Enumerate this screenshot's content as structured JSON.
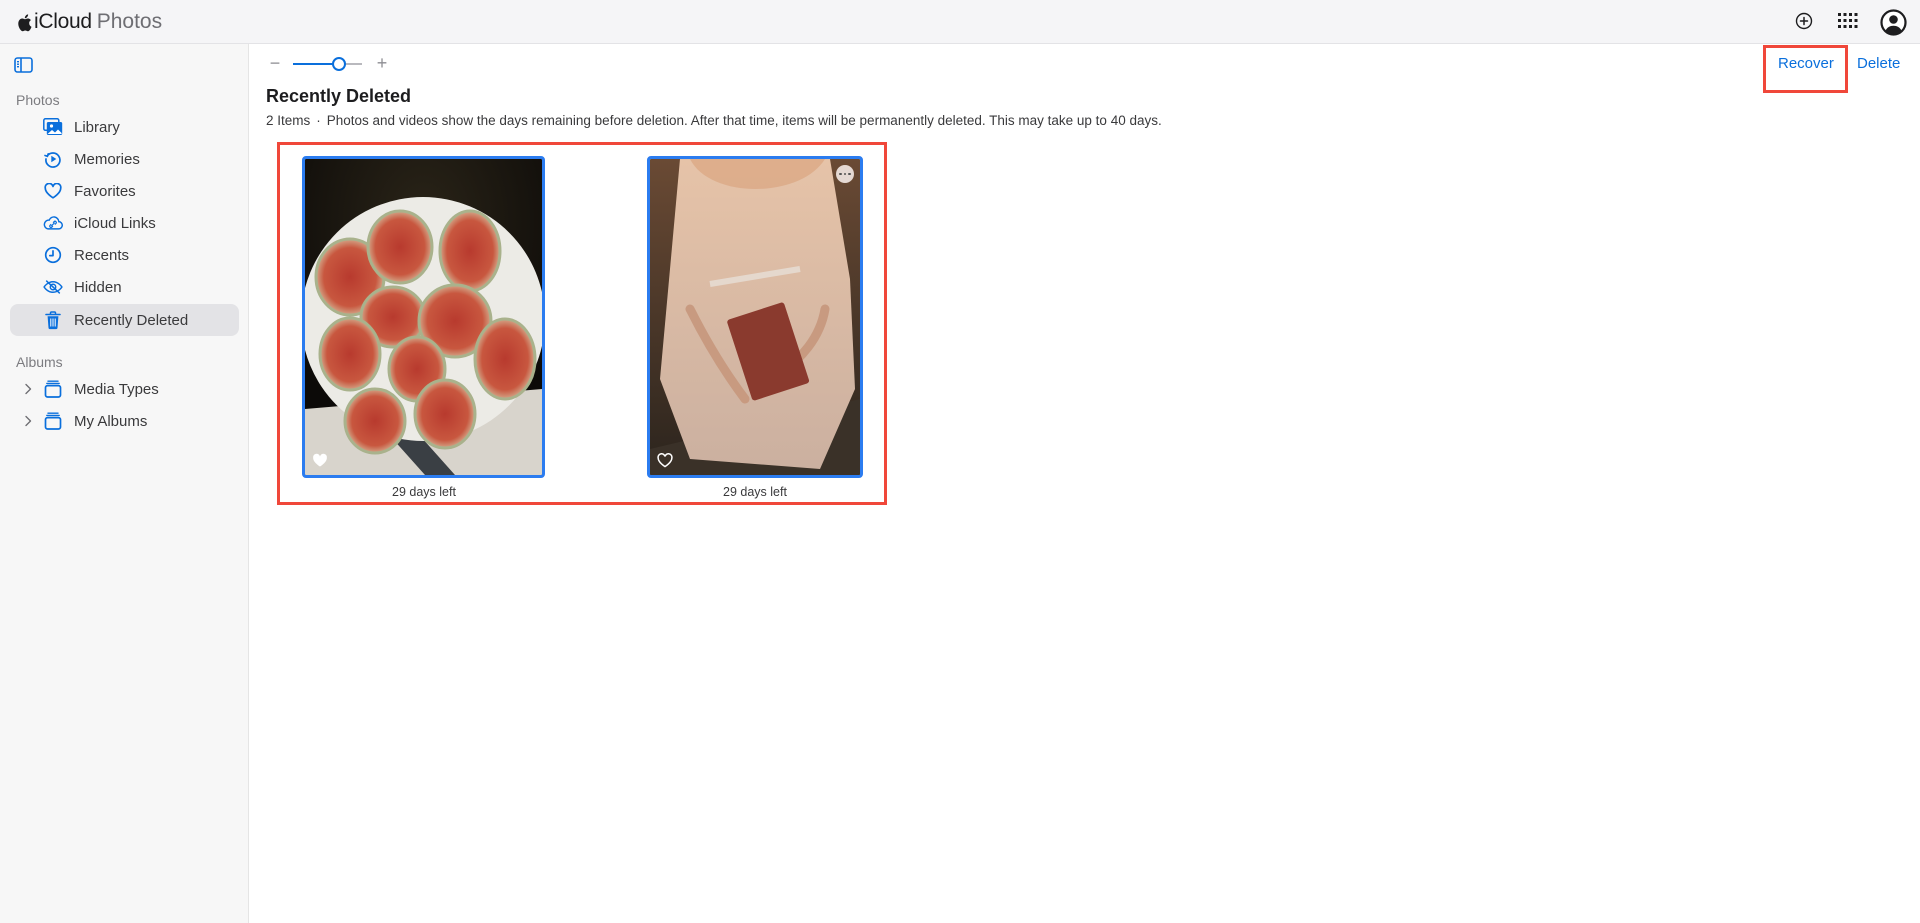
{
  "header": {
    "brand_primary": "iCloud",
    "brand_secondary": "Photos",
    "icons": [
      "apple-logo",
      "add-circle-icon",
      "app-grid-icon",
      "account-icon"
    ]
  },
  "sidebar": {
    "toggle_icon": "sidebar-toggle-icon",
    "photos_section": {
      "label": "Photos",
      "items": [
        {
          "label": "Library",
          "icon": "library-icon",
          "active": false
        },
        {
          "label": "Memories",
          "icon": "memories-icon",
          "active": false
        },
        {
          "label": "Favorites",
          "icon": "heart-icon",
          "active": false
        },
        {
          "label": "iCloud Links",
          "icon": "cloud-link-icon",
          "active": false
        },
        {
          "label": "Recents",
          "icon": "clock-icon",
          "active": false
        },
        {
          "label": "Hidden",
          "icon": "eye-slash-icon",
          "active": false
        },
        {
          "label": "Recently Deleted",
          "icon": "trash-icon",
          "active": true
        }
      ]
    },
    "albums_section": {
      "label": "Albums",
      "items": [
        {
          "label": "Media Types",
          "icon": "album-stack-icon",
          "expandable": true
        },
        {
          "label": "My Albums",
          "icon": "album-stack-icon",
          "expandable": true
        }
      ]
    }
  },
  "main": {
    "zoom": {
      "minus_label": "−",
      "plus_label": "+",
      "level": 0.67
    },
    "title": "Recently Deleted",
    "item_count": "2 Items",
    "separator": "·",
    "description": "Photos and videos show the days remaining before deletion. After that time, items will be permanently deleted. This may take up to 40 days.",
    "actions": {
      "recover_label": "Recover",
      "delete_label": "Delete"
    },
    "photos": [
      {
        "subject": "figs on white plate",
        "caption": "29 days left",
        "favorite": true,
        "selected": true
      },
      {
        "subject": "woman in tulle dress holding book",
        "caption": "29 days left",
        "favorite": false,
        "selected": true,
        "show_more_button": true
      }
    ]
  },
  "colors": {
    "accent": "#0a6fdc",
    "selection_border": "#2b7cf0",
    "highlight_annotation": "#f0473a",
    "topbar_bg": "#f5f5f7",
    "sidebar_bg": "#f7f7f7",
    "sidebar_active_bg": "#e3e3e6"
  }
}
